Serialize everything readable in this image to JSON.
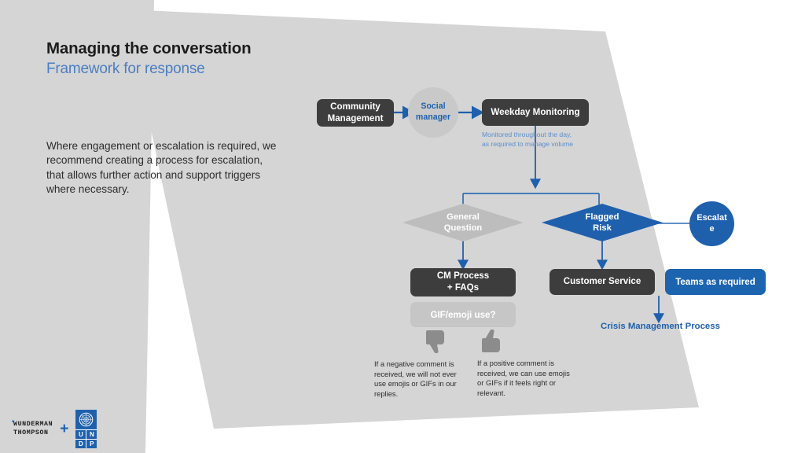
{
  "slide": {
    "title": "Managing the conversation",
    "subtitle": "Framework for response",
    "intro": "Where engagement or escalation is required, we recommend creating a process for escalation, that allows further action and support triggers where necessary."
  },
  "colors": {
    "accent_blue": "#1f60ad",
    "button_blue": "#1c64b0",
    "dark_box": "#3d3d3d",
    "light_gray_box": "#c6c6c6",
    "background_gray": "#d5d5d5",
    "subtitle_blue": "#4a7fc4",
    "caption_blue": "#5b8fcc"
  },
  "flow": {
    "community_management": "Community\nManagement",
    "community_management_line1": "Community",
    "community_management_line2": "Management",
    "social_manager_line1": "Social",
    "social_manager_line2": "manager",
    "weekday_monitoring": "Weekday Monitoring",
    "monitoring_caption_line1": "Monitored throughout the day,",
    "monitoring_caption_line2": "as required to manage volume",
    "general_question_line1": "General",
    "general_question_line2": "Question",
    "flagged_risk_line1": "Flagged",
    "flagged_risk_line2": "Risk",
    "escalate_line1": "Escalat",
    "escalate_line2": "e",
    "cm_process_line1": "CM Process",
    "cm_process_line2": "+ FAQs",
    "customer_service": "Customer Service",
    "teams_as_required": "Teams as required",
    "gif_emoji_use": "GIF/emoji use?",
    "crisis_management_process": "Crisis Management Process"
  },
  "notes": {
    "negative": "If a negative comment is received, we will not ever use emojis or GIFs in our replies.",
    "positive": "If a positive comment is received, we can use emojis or GIFs if it feels right or relevant."
  },
  "logos": {
    "wt_line1": "WUNDERMAN",
    "wt_line2": "THOMPSON",
    "plus": "+",
    "undp_letters": [
      "U",
      "N",
      "D",
      "P"
    ]
  }
}
